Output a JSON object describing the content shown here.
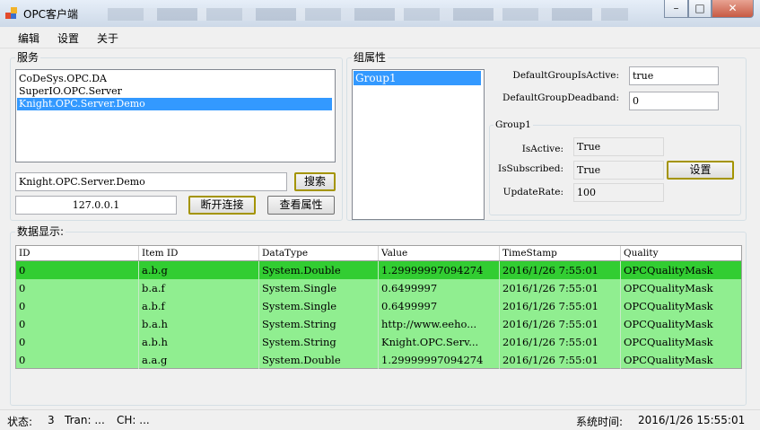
{
  "window": {
    "title": "OPC客户端",
    "min": "–",
    "max": "□",
    "close": "✕"
  },
  "menu": [
    "编辑",
    "设置",
    "关于"
  ],
  "services": {
    "label": "服务",
    "items": [
      "CoDeSys.OPC.DA",
      "SuperIO.OPC.Server",
      "Knight.OPC.Server.Demo"
    ],
    "selected_index": 2,
    "search_value": "Knight.OPC.Server.Demo",
    "search_button": "搜索",
    "ip": "127.0.0.1",
    "disconnect_button": "断开连接",
    "properties_button": "查看属性"
  },
  "group_props": {
    "label": "组属性",
    "groups": [
      "Group1"
    ],
    "default_active_label": "DefaultGroupIsActive:",
    "default_active_value": "true",
    "default_deadband_label": "DefaultGroupDeadband:",
    "default_deadband_value": "0",
    "group_box_label": "Group1",
    "is_active_label": "IsActive:",
    "is_active_value": "True",
    "is_subscribed_label": "IsSubscribed:",
    "is_subscribed_value": "True",
    "update_rate_label": "UpdateRate:",
    "update_rate_value": "100",
    "set_button": "设置"
  },
  "data_display": {
    "label": "数据显示:",
    "columns": [
      "ID",
      "Item ID",
      "DataType",
      "Value",
      "TimeStamp",
      "Quality"
    ],
    "rows": [
      [
        "0",
        "a.b.g",
        "System.Double",
        "1.29999997094274",
        "2016/1/26  7:55:01",
        "OPCQualityMask"
      ],
      [
        "0",
        "b.a.f",
        "System.Single",
        "0.6499997",
        "2016/1/26  7:55:01",
        "OPCQualityMask"
      ],
      [
        "0",
        "a.b.f",
        "System.Single",
        "0.6499997",
        "2016/1/26  7:55:01",
        "OPCQualityMask"
      ],
      [
        "0",
        "b.a.h",
        "System.String",
        "http://www.eeho...",
        "2016/1/26  7:55:01",
        "OPCQualityMask"
      ],
      [
        "0",
        "a.b.h",
        "System.String",
        "Knight.OPC.Serv...",
        "2016/1/26  7:55:01",
        "OPCQualityMask"
      ],
      [
        "0",
        "a.a.g",
        "System.Double",
        "1.29999997094274",
        "2016/1/26  7:55:01",
        "OPCQualityMask"
      ]
    ]
  },
  "status": {
    "state_label": "状态:",
    "state_value": "3",
    "tran": "Tran: ...",
    "ch": "CH: ...",
    "time_label": "系统时间:",
    "time_value": "2016/1/26 15:55:01"
  },
  "colors": {
    "row_selected": "#32cd32",
    "row_normal": "#90ee90",
    "list_selection": "#3399ff"
  }
}
